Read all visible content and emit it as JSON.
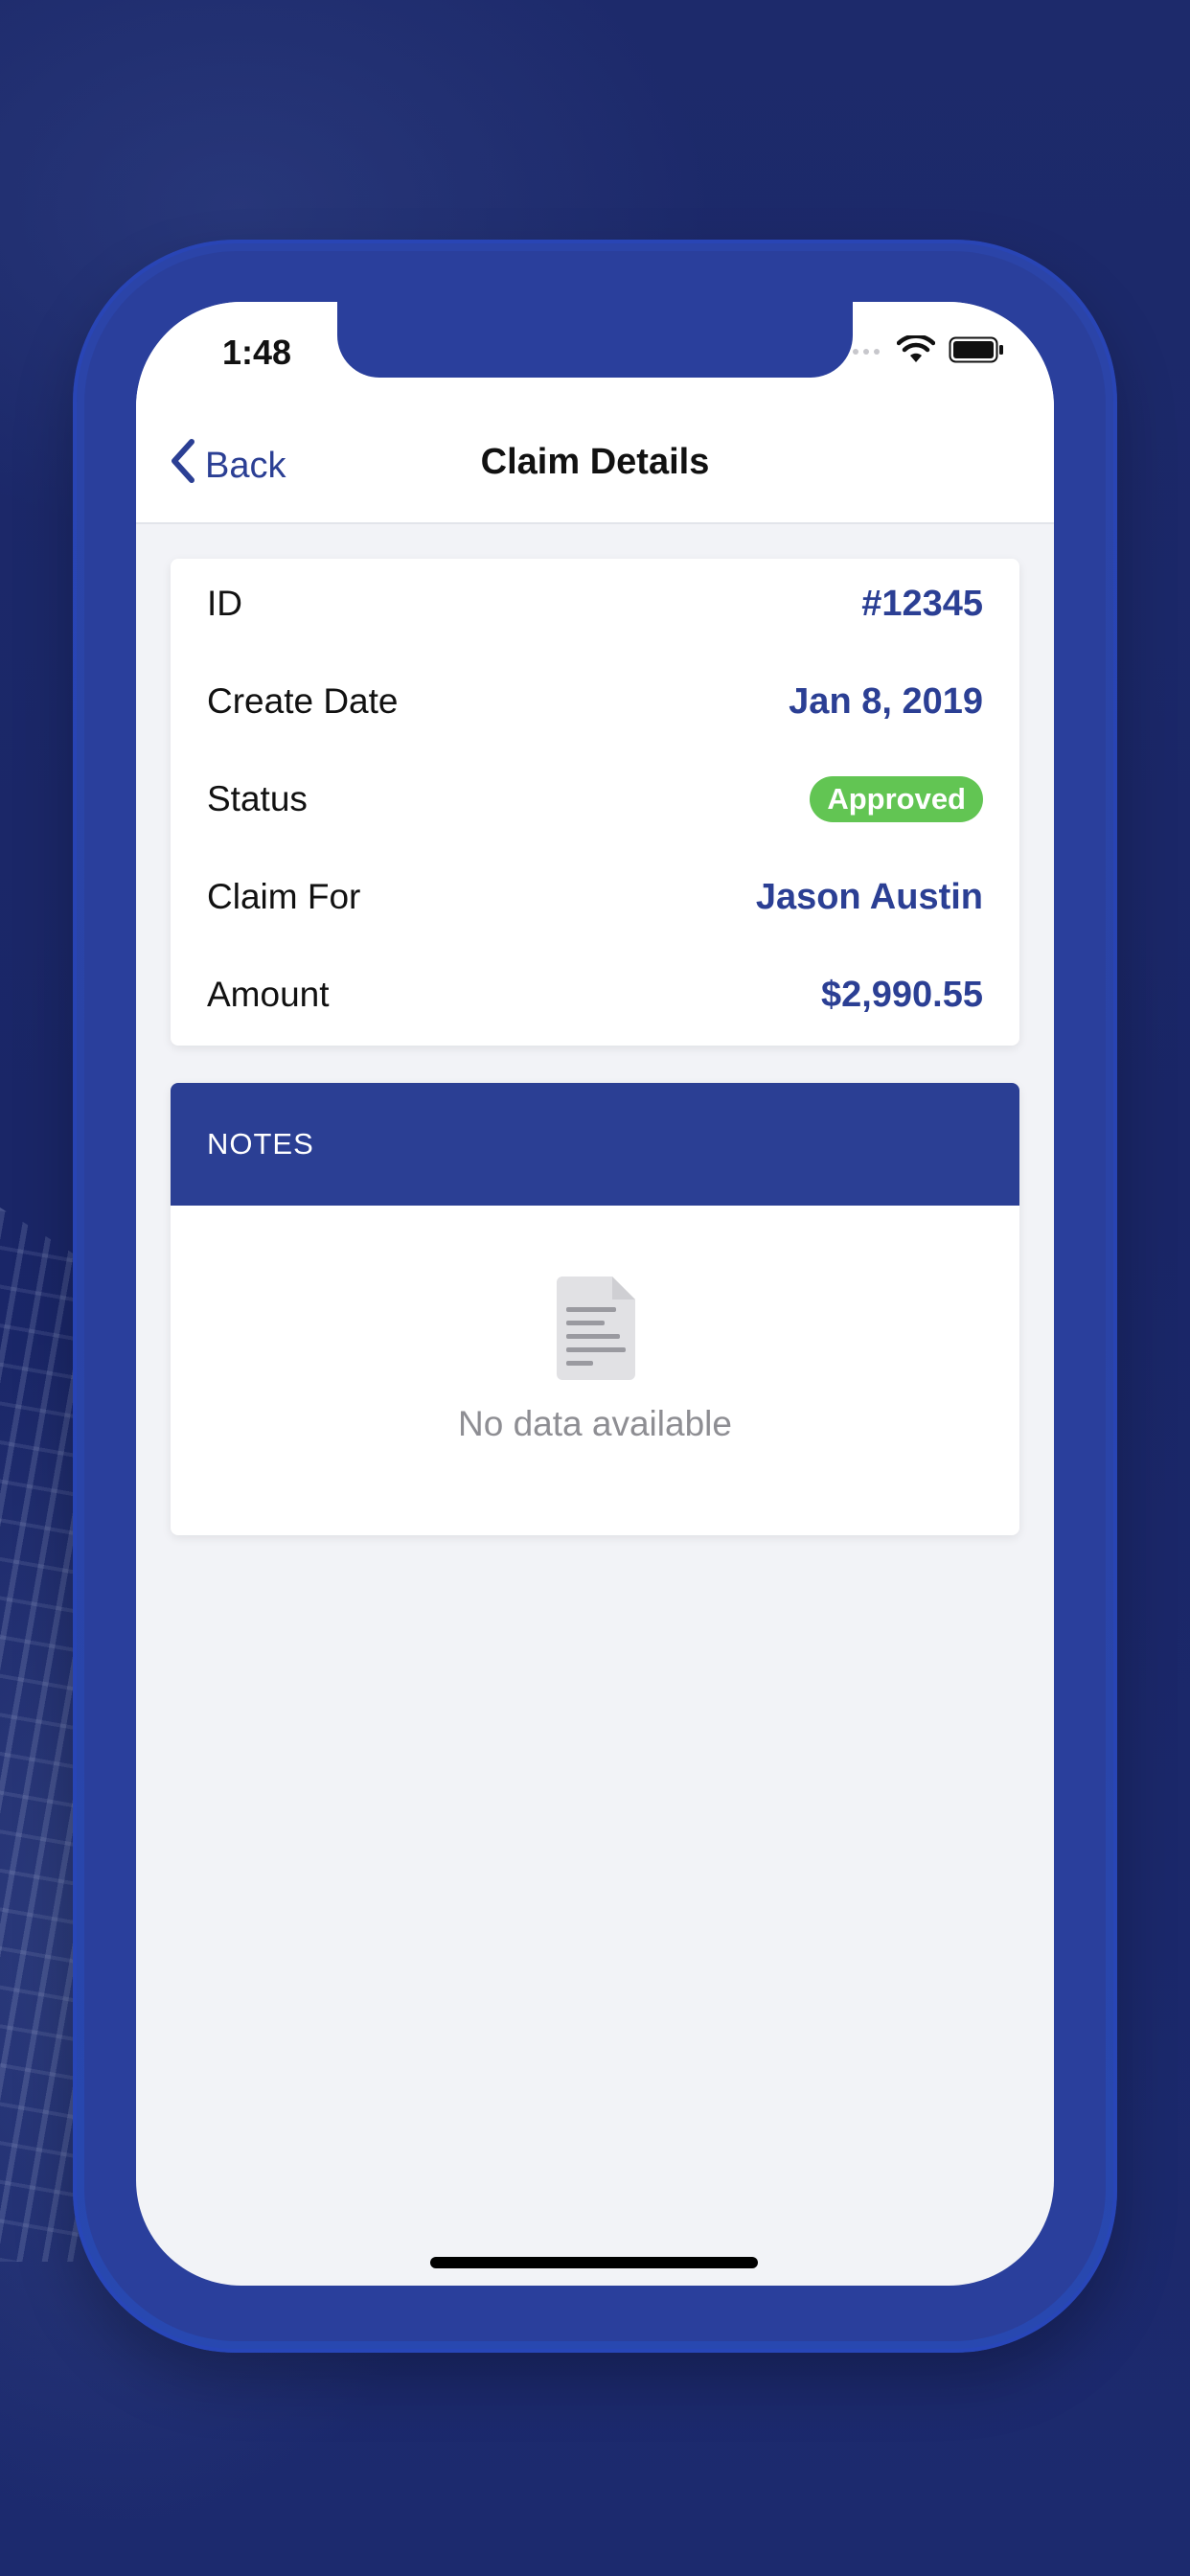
{
  "status_bar": {
    "time": "1:48"
  },
  "nav": {
    "back_label": "Back",
    "title": "Claim Details"
  },
  "details": [
    {
      "label": "ID",
      "value": "#12345"
    },
    {
      "label": "Create Date",
      "value": "Jan 8, 2019"
    },
    {
      "label": "Status",
      "value": "Approved"
    },
    {
      "label": "Claim For",
      "value": "Jason Austin"
    },
    {
      "label": "Amount",
      "value": "$2,990.55"
    }
  ],
  "notes": {
    "header": "NOTES",
    "empty_text": "No data available",
    "empty_icon": "document-icon"
  },
  "colors": {
    "brand": "#2b3f94",
    "status_approved": "#62c553",
    "background": "#1b2868"
  }
}
